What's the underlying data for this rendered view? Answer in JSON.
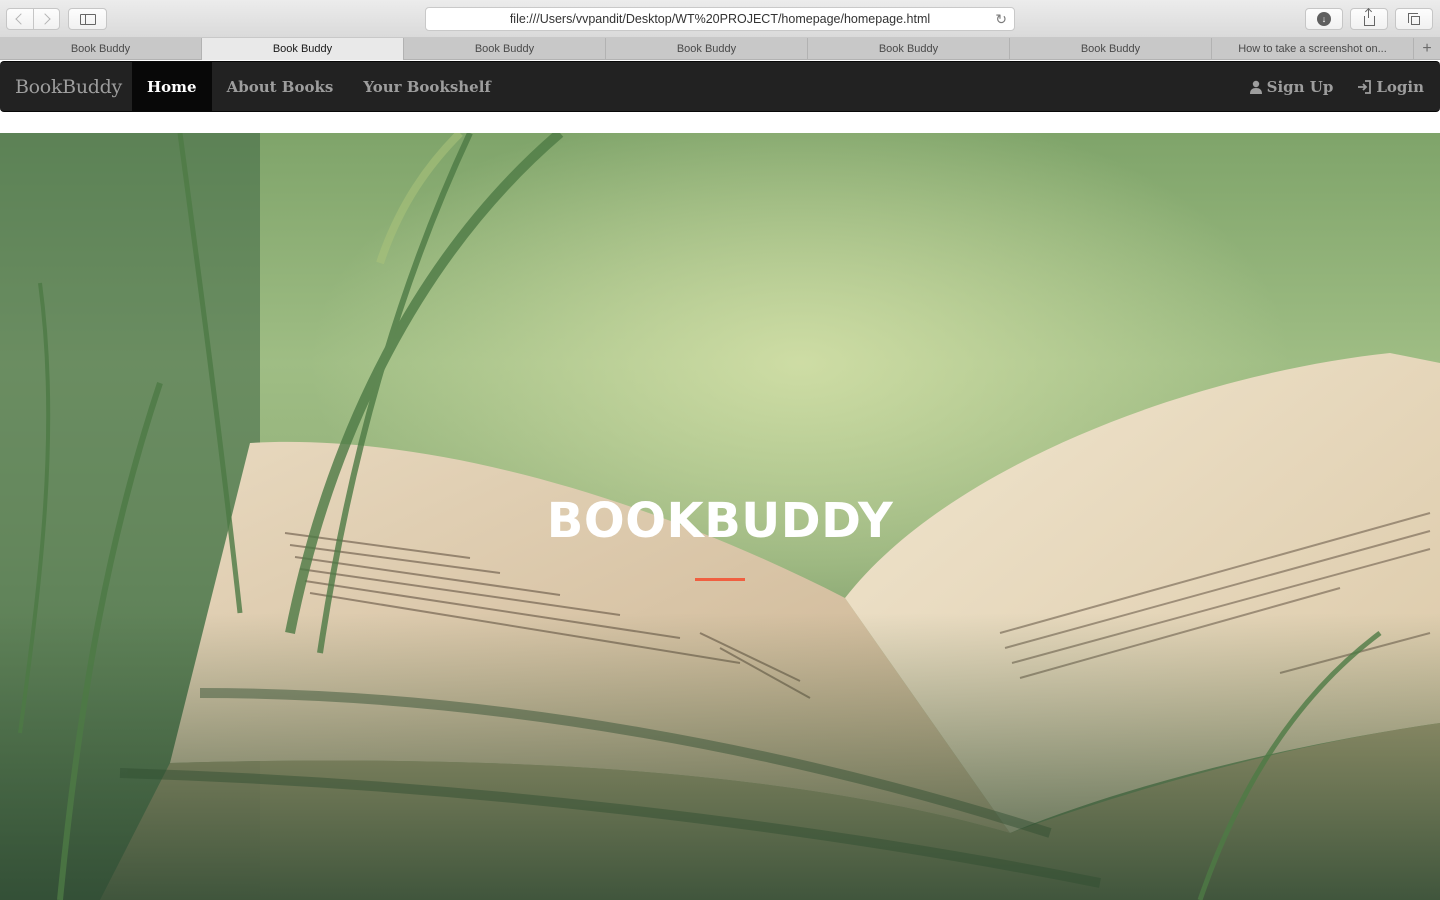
{
  "browser": {
    "url": "file:///Users/vvpandit/Desktop/WT%20PROJECT/homepage/homepage.html",
    "tabs": [
      {
        "label": "Book Buddy",
        "active": false
      },
      {
        "label": "Book Buddy",
        "active": true
      },
      {
        "label": "Book Buddy",
        "active": false
      },
      {
        "label": "Book Buddy",
        "active": false
      },
      {
        "label": "Book Buddy",
        "active": false
      },
      {
        "label": "Book Buddy",
        "active": false
      },
      {
        "label": "How to take a screenshot on...",
        "active": false
      }
    ],
    "icons": {
      "back": "chevron-left-icon",
      "forward": "chevron-right-icon",
      "sidebar": "sidebar-icon",
      "reload": "reload-icon",
      "downloads": "download-icon",
      "share": "share-icon",
      "tabs_overview": "tabs-icon",
      "new_tab": "plus-icon"
    }
  },
  "navbar": {
    "brand": "BookBuddy",
    "links": [
      {
        "label": "Home",
        "active": true
      },
      {
        "label": "About Books",
        "active": false
      },
      {
        "label": "Your Bookshelf",
        "active": false
      }
    ],
    "right": [
      {
        "label": "Sign Up",
        "icon": "user-icon"
      },
      {
        "label": "Login",
        "icon": "login-icon"
      }
    ]
  },
  "hero": {
    "title": "BOOKBUDDY",
    "accent_color": "#f05f40"
  },
  "colors": {
    "navbar_bg": "#222222",
    "navbar_active": "#080808",
    "navbar_text": "#9d9d9d"
  }
}
